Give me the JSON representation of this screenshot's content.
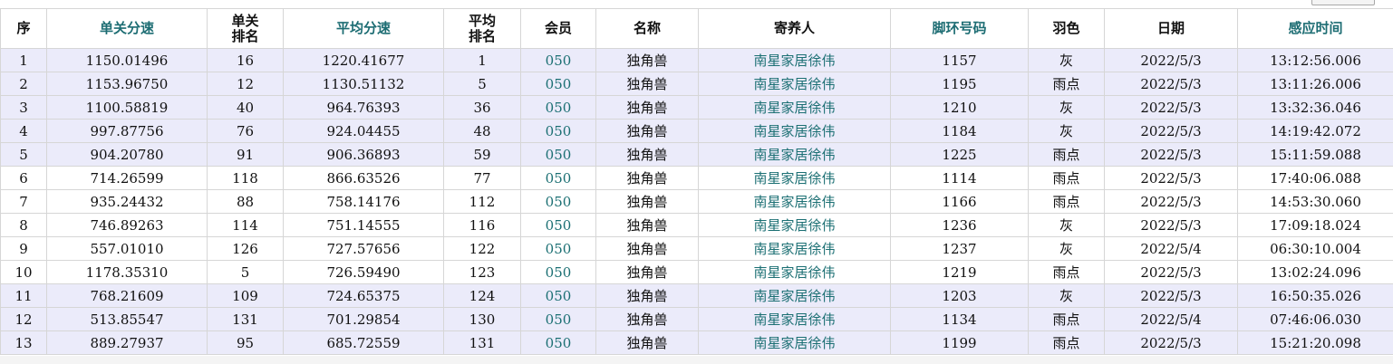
{
  "headers": {
    "seq": "序",
    "single_speed": "单关分速",
    "single_rank": "单关排名",
    "avg_speed": "平均分速",
    "avg_rank": "平均排名",
    "member": "会员",
    "name": "名称",
    "owner": "寄养人",
    "ring": "脚环号码",
    "feather": "羽色",
    "date": "日期",
    "time": "感应时间"
  },
  "rows": [
    {
      "seq": "1",
      "single_speed": "1150.01496",
      "single_rank": "16",
      "avg_speed": "1220.41677",
      "avg_rank": "1",
      "member": "050",
      "name": "独角兽",
      "owner": "南星家居徐伟",
      "ring": "1157",
      "feather": "灰",
      "date": "2022/5/3",
      "time": "13:12:56.006"
    },
    {
      "seq": "2",
      "single_speed": "1153.96750",
      "single_rank": "12",
      "avg_speed": "1130.51132",
      "avg_rank": "5",
      "member": "050",
      "name": "独角兽",
      "owner": "南星家居徐伟",
      "ring": "1195",
      "feather": "雨点",
      "date": "2022/5/3",
      "time": "13:11:26.006"
    },
    {
      "seq": "3",
      "single_speed": "1100.58819",
      "single_rank": "40",
      "avg_speed": "964.76393",
      "avg_rank": "36",
      "member": "050",
      "name": "独角兽",
      "owner": "南星家居徐伟",
      "ring": "1210",
      "feather": "灰",
      "date": "2022/5/3",
      "time": "13:32:36.046"
    },
    {
      "seq": "4",
      "single_speed": "997.87756",
      "single_rank": "76",
      "avg_speed": "924.04455",
      "avg_rank": "48",
      "member": "050",
      "name": "独角兽",
      "owner": "南星家居徐伟",
      "ring": "1184",
      "feather": "灰",
      "date": "2022/5/3",
      "time": "14:19:42.072"
    },
    {
      "seq": "5",
      "single_speed": "904.20780",
      "single_rank": "91",
      "avg_speed": "906.36893",
      "avg_rank": "59",
      "member": "050",
      "name": "独角兽",
      "owner": "南星家居徐伟",
      "ring": "1225",
      "feather": "雨点",
      "date": "2022/5/3",
      "time": "15:11:59.088"
    },
    {
      "seq": "6",
      "single_speed": "714.26599",
      "single_rank": "118",
      "avg_speed": "866.63526",
      "avg_rank": "77",
      "member": "050",
      "name": "独角兽",
      "owner": "南星家居徐伟",
      "ring": "1114",
      "feather": "雨点",
      "date": "2022/5/3",
      "time": "17:40:06.088"
    },
    {
      "seq": "7",
      "single_speed": "935.24432",
      "single_rank": "88",
      "avg_speed": "758.14176",
      "avg_rank": "112",
      "member": "050",
      "name": "独角兽",
      "owner": "南星家居徐伟",
      "ring": "1166",
      "feather": "雨点",
      "date": "2022/5/3",
      "time": "14:53:30.060"
    },
    {
      "seq": "8",
      "single_speed": "746.89263",
      "single_rank": "114",
      "avg_speed": "751.14555",
      "avg_rank": "116",
      "member": "050",
      "name": "独角兽",
      "owner": "南星家居徐伟",
      "ring": "1236",
      "feather": "灰",
      "date": "2022/5/3",
      "time": "17:09:18.024"
    },
    {
      "seq": "9",
      "single_speed": "557.01010",
      "single_rank": "126",
      "avg_speed": "727.57656",
      "avg_rank": "122",
      "member": "050",
      "name": "独角兽",
      "owner": "南星家居徐伟",
      "ring": "1237",
      "feather": "灰",
      "date": "2022/5/4",
      "time": "06:30:10.004"
    },
    {
      "seq": "10",
      "single_speed": "1178.35310",
      "single_rank": "5",
      "avg_speed": "726.59490",
      "avg_rank": "123",
      "member": "050",
      "name": "独角兽",
      "owner": "南星家居徐伟",
      "ring": "1219",
      "feather": "雨点",
      "date": "2022/5/3",
      "time": "13:02:24.096"
    },
    {
      "seq": "11",
      "single_speed": "768.21609",
      "single_rank": "109",
      "avg_speed": "724.65375",
      "avg_rank": "124",
      "member": "050",
      "name": "独角兽",
      "owner": "南星家居徐伟",
      "ring": "1203",
      "feather": "灰",
      "date": "2022/5/3",
      "time": "16:50:35.026"
    },
    {
      "seq": "12",
      "single_speed": "513.85547",
      "single_rank": "131",
      "avg_speed": "701.29854",
      "avg_rank": "130",
      "member": "050",
      "name": "独角兽",
      "owner": "南星家居徐伟",
      "ring": "1134",
      "feather": "雨点",
      "date": "2022/5/4",
      "time": "07:46:06.030"
    },
    {
      "seq": "13",
      "single_speed": "889.27937",
      "single_rank": "95",
      "avg_speed": "685.72559",
      "avg_rank": "131",
      "member": "050",
      "name": "独角兽",
      "owner": "南星家居徐伟",
      "ring": "1199",
      "feather": "雨点",
      "date": "2022/5/3",
      "time": "15:21:20.098"
    }
  ],
  "colors": {
    "row_alt": "#ebebfa",
    "link": "#1b6f73"
  }
}
